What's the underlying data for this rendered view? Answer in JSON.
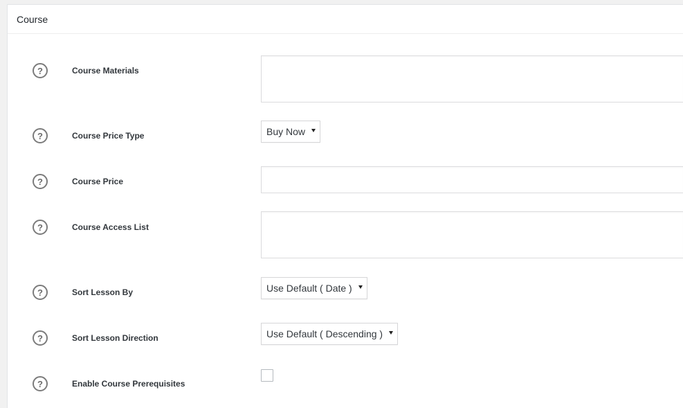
{
  "panel": {
    "title": "Course"
  },
  "help_icon_glyph": "?",
  "fields": {
    "course_materials": {
      "label": "Course Materials",
      "value": ""
    },
    "course_price_type": {
      "label": "Course Price Type",
      "selected": "Buy Now"
    },
    "course_price": {
      "label": "Course Price",
      "value": ""
    },
    "course_access_list": {
      "label": "Course Access List",
      "value": ""
    },
    "sort_lesson_by": {
      "label": "Sort Lesson By",
      "selected": "Use Default ( Date )"
    },
    "sort_lesson_direction": {
      "label": "Sort Lesson Direction",
      "selected": "Use Default ( Descending )"
    },
    "enable_course_prerequisites": {
      "label": "Enable Course Prerequisites",
      "checked": false
    }
  },
  "icons": {
    "help": "question-circle-icon",
    "dropdown": "caret-down-icon"
  },
  "colors": {
    "page_background": "#f1f1f1",
    "panel_background": "#ffffff",
    "label_text": "#32373c",
    "icon_stroke": "#7b7b7b"
  }
}
